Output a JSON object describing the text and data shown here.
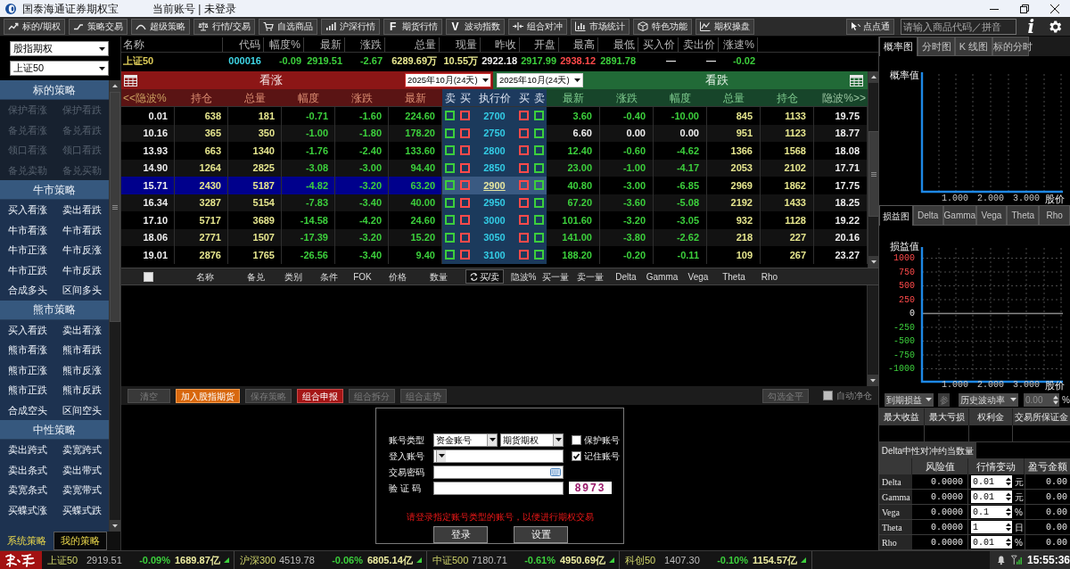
{
  "window": {
    "title": "国泰海通证券期权宝",
    "account_status": "当前账号 | 未登录"
  },
  "toolbar": {
    "buttons": [
      {
        "label": "标的/期权"
      },
      {
        "label": "策略交易"
      },
      {
        "label": "超级策略"
      },
      {
        "label": "行情/交易"
      },
      {
        "label": "自选商品"
      },
      {
        "label": "沪深行情"
      },
      {
        "label": "期货行情",
        "glyph": "F"
      },
      {
        "label": "波动指数",
        "glyph": "V"
      },
      {
        "label": "组合对冲"
      },
      {
        "label": "市场统计"
      },
      {
        "label": "特色功能"
      },
      {
        "label": "期权操盘"
      }
    ],
    "quick_button": "点点通",
    "search": {
      "placeholder": "请输入商品代码／拼音"
    },
    "info_glyph": "i"
  },
  "sidebar": {
    "selects": [
      "股指期权",
      "上证50"
    ],
    "sections": [
      {
        "title": "标的策略",
        "disabled": true,
        "items": [
          "保护看涨",
          "保护看跌",
          "备兑看涨",
          "备兑看跌",
          "领口看涨",
          "领口看跌",
          "备兑卖勒",
          "备兑买勒"
        ]
      },
      {
        "title": "牛市策略",
        "disabled": false,
        "items": [
          "买入看涨",
          "卖出看跌",
          "牛市看涨",
          "牛市看跌",
          "牛市正涨",
          "牛市反涨",
          "牛市正跌",
          "牛市反跌",
          "合成多头",
          "区间多头"
        ]
      },
      {
        "title": "熊市策略",
        "disabled": false,
        "items": [
          "买入看跌",
          "卖出看涨",
          "熊市看涨",
          "熊市看跌",
          "熊市正涨",
          "熊市反涨",
          "熊市正跌",
          "熊市反跌",
          "合成空头",
          "区间空头"
        ]
      },
      {
        "title": "中性策略",
        "disabled": false,
        "items": [
          "卖出跨式",
          "卖宽跨式",
          "卖出条式",
          "卖出带式",
          "卖宽条式",
          "卖宽带式",
          "买蝶式涨",
          "买蝶式跌"
        ]
      }
    ],
    "tabs": [
      {
        "label": "系统策略",
        "selected": true
      },
      {
        "label": "我的策略",
        "selected": false
      }
    ]
  },
  "quote": {
    "columns": [
      "名称",
      "代码",
      "幅度%",
      "最新",
      "涨跌",
      "总量",
      "现量",
      "昨收",
      "开盘",
      "最高",
      "最低",
      "买入价",
      "卖出价",
      "涨速%"
    ],
    "cells": [
      {
        "text": "上证50",
        "kind": "name"
      },
      {
        "text": "000016",
        "kind": "code"
      },
      {
        "text": "-0.09",
        "kind": "down"
      },
      {
        "text": "2919.51",
        "kind": "down"
      },
      {
        "text": "-2.67",
        "kind": "down"
      },
      {
        "text": "6289.69万",
        "kind": "volume"
      },
      {
        "text": "10.55万",
        "kind": "volume"
      },
      {
        "text": "2922.18",
        "kind": "flat"
      },
      {
        "text": "2917.99",
        "kind": "down"
      },
      {
        "text": "2938.12",
        "kind": "up"
      },
      {
        "text": "2891.78",
        "kind": "down"
      },
      {
        "text": "—",
        "kind": "flat"
      },
      {
        "text": "—",
        "kind": "flat"
      },
      {
        "text": "-0.02",
        "kind": "down"
      }
    ]
  },
  "chain": {
    "call_title": "看涨",
    "put_title": "看跌",
    "expiry_selects": [
      "2025年10月(24天)",
      "2025年10月(24天)"
    ],
    "call_columns": [
      "<<隐波%",
      "持仓",
      "总量",
      "幅度",
      "涨跌",
      "最新"
    ],
    "middle_columns": [
      "卖",
      "买",
      "执行价",
      "买",
      "卖"
    ],
    "put_columns": [
      "最新",
      "涨跌",
      "幅度",
      "总量",
      "持仓",
      "隐波%>>"
    ],
    "rows": [
      {
        "strike": "2700",
        "selected": false,
        "call": {
          "values": [
            "0.01",
            "638",
            "181",
            "-0.71",
            "-1.60",
            "224.60"
          ],
          "kind": "down"
        },
        "put": {
          "values": [
            "3.60",
            "-0.40",
            "-10.00",
            "845",
            "1133",
            "19.75"
          ],
          "kind": "down"
        }
      },
      {
        "strike": "2750",
        "selected": false,
        "call": {
          "values": [
            "10.16",
            "365",
            "350",
            "-1.00",
            "-1.80",
            "178.20"
          ],
          "kind": "down"
        },
        "put": {
          "values": [
            "6.60",
            "0.00",
            "0.00",
            "951",
            "1123",
            "18.77"
          ],
          "kind": "flat"
        }
      },
      {
        "strike": "2800",
        "selected": false,
        "call": {
          "values": [
            "13.93",
            "663",
            "1340",
            "-1.76",
            "-2.40",
            "133.60"
          ],
          "kind": "down"
        },
        "put": {
          "values": [
            "12.40",
            "-0.60",
            "-4.62",
            "1366",
            "1568",
            "18.08"
          ],
          "kind": "down"
        }
      },
      {
        "strike": "2850",
        "selected": false,
        "call": {
          "values": [
            "14.90",
            "1264",
            "2825",
            "-3.08",
            "-3.00",
            "94.40"
          ],
          "kind": "down"
        },
        "put": {
          "values": [
            "23.00",
            "-1.00",
            "-4.17",
            "2053",
            "2102",
            "17.71"
          ],
          "kind": "down"
        }
      },
      {
        "strike": "2900",
        "selected": true,
        "call": {
          "values": [
            "15.71",
            "2430",
            "5187",
            "-4.82",
            "-3.20",
            "63.20"
          ],
          "kind": "down"
        },
        "put": {
          "values": [
            "40.80",
            "-3.00",
            "-6.85",
            "2969",
            "1862",
            "17.75"
          ],
          "kind": "down"
        }
      },
      {
        "strike": "2950",
        "selected": false,
        "call": {
          "values": [
            "16.34",
            "3287",
            "5154",
            "-7.83",
            "-3.40",
            "40.00"
          ],
          "kind": "down"
        },
        "put": {
          "values": [
            "67.20",
            "-3.60",
            "-5.08",
            "2192",
            "1433",
            "18.25"
          ],
          "kind": "down"
        }
      },
      {
        "strike": "3000",
        "selected": false,
        "call": {
          "values": [
            "17.10",
            "5717",
            "3689",
            "-14.58",
            "-4.20",
            "24.60"
          ],
          "kind": "down"
        },
        "put": {
          "values": [
            "101.60",
            "-3.20",
            "-3.05",
            "932",
            "1128",
            "19.22"
          ],
          "kind": "down"
        }
      },
      {
        "strike": "3050",
        "selected": false,
        "call": {
          "values": [
            "18.06",
            "2771",
            "1507",
            "-17.39",
            "-3.20",
            "15.20"
          ],
          "kind": "down"
        },
        "put": {
          "values": [
            "141.00",
            "-3.80",
            "-2.62",
            "218",
            "227",
            "20.16"
          ],
          "kind": "down"
        }
      },
      {
        "strike": "3100",
        "selected": false,
        "call": {
          "values": [
            "19.01",
            "2876",
            "1765",
            "-26.56",
            "-3.40",
            "9.40"
          ],
          "kind": "down"
        },
        "put": {
          "values": [
            "188.20",
            "-0.20",
            "-0.11",
            "109",
            "267",
            "23.27"
          ],
          "kind": "down"
        }
      }
    ]
  },
  "orders": {
    "select_all": {
      "checked": false
    },
    "columns": [
      {
        "label": "名称",
        "kind": "label"
      },
      {
        "label": "备兑",
        "kind": "label"
      },
      {
        "label": "类别",
        "kind": "label"
      },
      {
        "label": "条件",
        "kind": "label"
      },
      {
        "label": "FOK",
        "kind": "label"
      },
      {
        "label": "价格",
        "kind": "label"
      },
      {
        "label": "数量",
        "kind": "label"
      },
      {
        "label": "买/卖",
        "kind": "toggle"
      },
      {
        "label": "隐波%",
        "kind": "label"
      },
      {
        "label": "买一量",
        "kind": "label"
      },
      {
        "label": "卖一量",
        "kind": "label"
      },
      {
        "label": "Delta",
        "kind": "label"
      },
      {
        "label": "Gamma",
        "kind": "label"
      },
      {
        "label": "Vega",
        "kind": "label"
      },
      {
        "label": "Theta",
        "kind": "label"
      },
      {
        "label": "Rho",
        "kind": "label"
      }
    ]
  },
  "actions": {
    "buttons": [
      {
        "label": "清空",
        "kind": "disabled"
      },
      {
        "label": "加入股指期货",
        "kind": "highlight"
      },
      {
        "label": "保存策略",
        "kind": "disabled"
      },
      {
        "label": "组合申报",
        "kind": "primary"
      },
      {
        "label": "组合拆分",
        "kind": "disabled"
      },
      {
        "label": "组合走势",
        "kind": "disabled"
      }
    ],
    "right_button": {
      "label": "勾选全平",
      "kind": "disabled"
    },
    "auto_net": {
      "label": "自动净仓",
      "checked": false
    }
  },
  "login": {
    "fields": [
      {
        "label": "账号类型",
        "kind": "selects",
        "values": [
          "资金账号",
          "期货期权"
        ]
      },
      {
        "label": "登入账号",
        "kind": "select"
      },
      {
        "label": "交易密码",
        "kind": "password"
      },
      {
        "label": "验 证 码",
        "kind": "captcha",
        "captcha": "8973"
      }
    ],
    "checkboxes": [
      {
        "label": "保护账号",
        "checked": false
      },
      {
        "label": "记住账号",
        "checked": true
      }
    ],
    "message": "请登录指定账号类型的账号，以便进行期权交易",
    "buttons": [
      "登录",
      "设置"
    ]
  },
  "analysis": {
    "view_tabs": [
      {
        "label": "概率图",
        "selected": true
      },
      {
        "label": "分时图",
        "selected": false
      },
      {
        "label": "K 线图",
        "selected": false
      },
      {
        "label": "标的分时",
        "selected": false
      }
    ],
    "probability_chart": {
      "ylabel": "概率值",
      "xticks": [
        "1.000",
        "2.000",
        "3.000"
      ],
      "xlabel": "股价"
    },
    "greek_tabs": [
      {
        "label": "损益图",
        "selected": true
      },
      {
        "label": "Delta",
        "selected": false
      },
      {
        "label": "Gamma",
        "selected": false
      },
      {
        "label": "Vega",
        "selected": false
      },
      {
        "label": "Theta",
        "selected": false
      },
      {
        "label": "Rho",
        "selected": false
      }
    ],
    "pl_chart": {
      "ylabel": "损益值",
      "yticks": [
        {
          "label": "1000",
          "kind": "up"
        },
        {
          "label": "750",
          "kind": "up"
        },
        {
          "label": "500",
          "kind": "up"
        },
        {
          "label": "250",
          "kind": "up"
        },
        {
          "label": "0",
          "kind": "zero"
        },
        {
          "label": "-250",
          "kind": "down"
        },
        {
          "label": "-500",
          "kind": "down"
        },
        {
          "label": "-750",
          "kind": "down"
        },
        {
          "label": "-1000",
          "kind": "down"
        }
      ],
      "xticks": [
        "1.000",
        "2.000",
        "3.000"
      ],
      "xlabel": "股价"
    },
    "controls": {
      "mode": "到期损益",
      "param_button": "参",
      "volatility": "历史波动率",
      "volatility_value": "0.00",
      "unit": "%"
    },
    "summary_columns": [
      "最大收益",
      "最大亏损",
      "权利金",
      "交易所保证金"
    ],
    "hedge_label": "Delta中性对冲约当数量",
    "risk_columns": [
      "风险值",
      "行情变动",
      "盈亏金额"
    ],
    "risk_rows": [
      {
        "greek": "Delta",
        "value": "0.0000",
        "step": "0.01",
        "unit": "元",
        "pl": "0.00"
      },
      {
        "greek": "Gamma",
        "value": "0.0000",
        "step": "0.01",
        "unit": "元",
        "pl": "0.00"
      },
      {
        "greek": "Vega",
        "value": "0.0000",
        "step": "0.1",
        "unit": "%",
        "pl": "0.00"
      },
      {
        "greek": "Theta",
        "value": "0.0000",
        "step": "1",
        "unit": "日",
        "pl": "0.00"
      },
      {
        "greek": "Rho",
        "value": "0.0000",
        "step": "0.01",
        "unit": "%",
        "pl": "0.00"
      }
    ]
  },
  "status_bar": {
    "tickers": [
      {
        "name": "上证50",
        "price": "2919.51",
        "change": "-0.09%",
        "amount": "1689.87亿",
        "kind": "down"
      },
      {
        "name": "沪深300",
        "price": "4519.78",
        "change": "-0.06%",
        "amount": "6805.14亿",
        "kind": "down"
      },
      {
        "name": "中证500",
        "price": "7180.71",
        "change": "-0.61%",
        "amount": "4950.69亿",
        "kind": "down"
      },
      {
        "name": "科创50",
        "price": "1407.30",
        "change": "-0.10%",
        "amount": "1154.57亿",
        "kind": "down"
      }
    ],
    "time": "15:55:36"
  }
}
